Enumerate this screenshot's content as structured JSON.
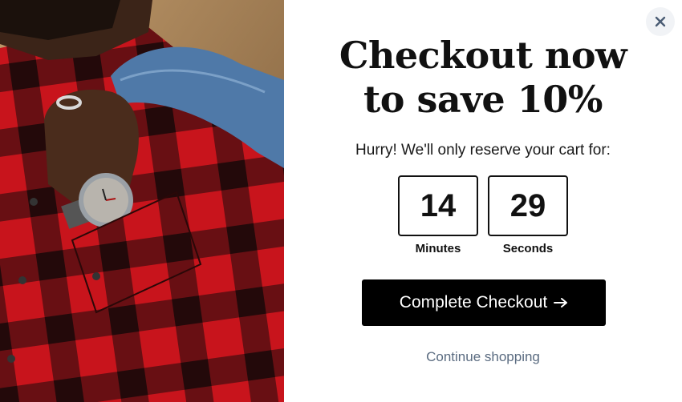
{
  "popup": {
    "close_label": "X",
    "headline_line1": "Checkout now",
    "headline_line2": "to save 10%",
    "subtext": "Hurry! We'll only reserve your cart for:",
    "timer": {
      "minutes_value": "14",
      "minutes_label": "Minutes",
      "seconds_value": "29",
      "seconds_label": "Seconds"
    },
    "checkout_button_label": "Complete Checkout",
    "checkout_button_icon": "arrow-right-icon",
    "continue_link": "Continue shopping"
  },
  "hero_image": {
    "description_icon": "product-photo"
  },
  "colors": {
    "primary_button": "#000000",
    "link": "#5a6b80",
    "plaid_red": "#c8141c",
    "denim": "#4f79a8"
  }
}
